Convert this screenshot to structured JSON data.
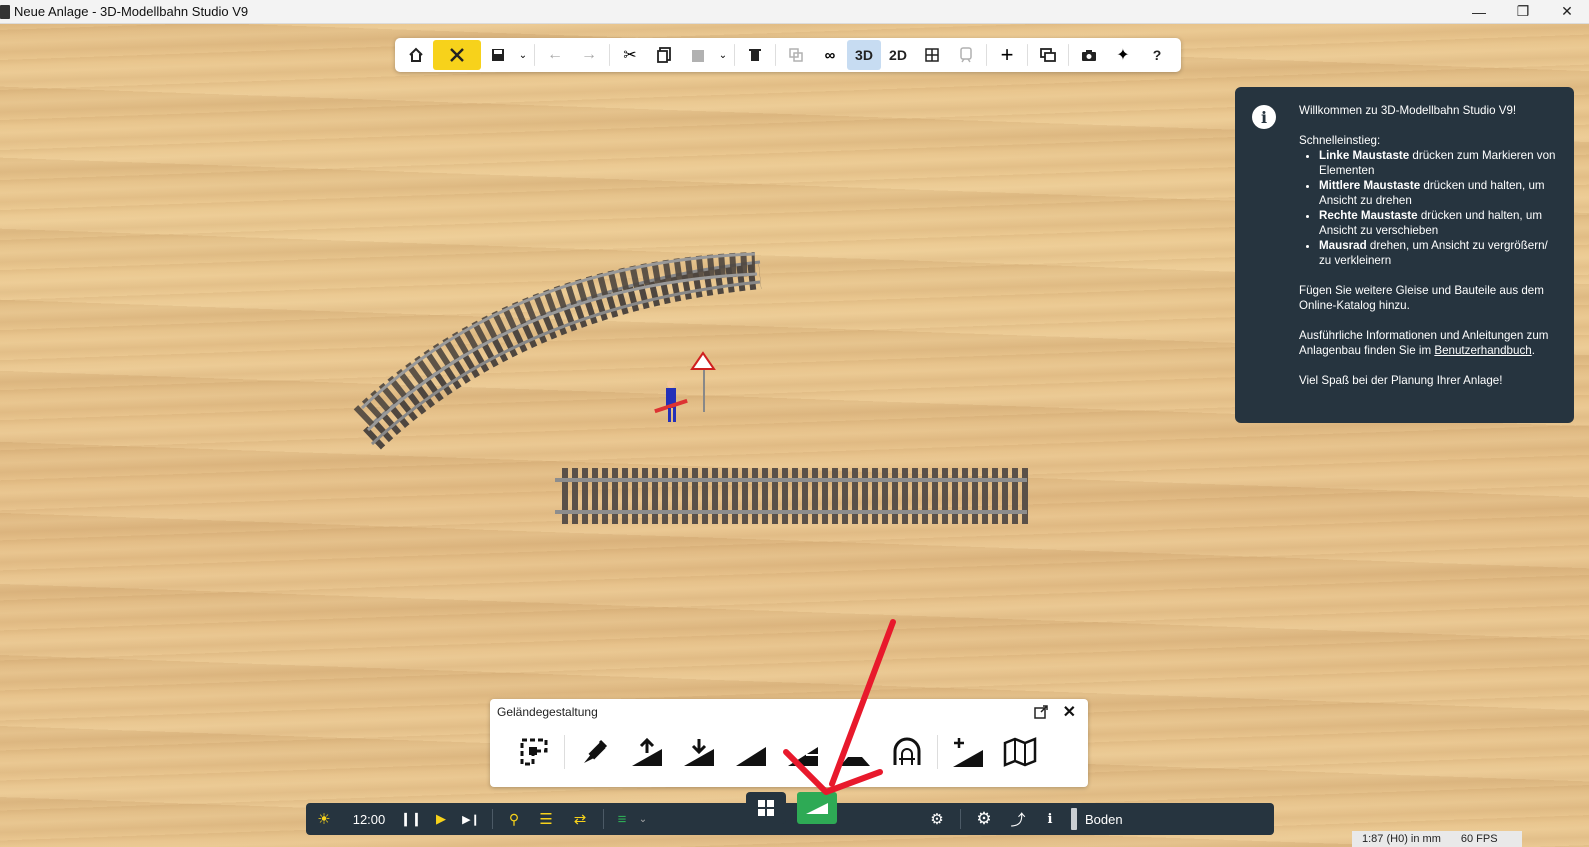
{
  "window": {
    "title": "Neue Anlage - 3D-Modellbahn Studio V9",
    "controls": [
      "minimize-icon",
      "restore-icon",
      "close-icon"
    ]
  },
  "toolbar": {
    "view_3d": "3D",
    "view_2d": "2D",
    "help": "?",
    "icons": [
      "home-icon",
      "tools-icon",
      "save-icon",
      "undo-icon",
      "redo-icon",
      "cut-icon",
      "copy-icon",
      "paste-icon",
      "delete-icon",
      "group-icon",
      "link-icon",
      "grid-view-icon",
      "train-icon",
      "add-icon",
      "windows-icon",
      "camera-icon",
      "plugin-icon"
    ]
  },
  "info_panel": {
    "welcome": "Willkommen zu 3D-Modellbahn Studio V9!",
    "quickstart_title": "Schnelleinstieg:",
    "tips": [
      {
        "bold": "Linke Maustaste",
        "text": " drücken zum Markieren von Elementen"
      },
      {
        "bold": "Mittlere Maustaste",
        "text": " drücken und halten, um Ansicht zu drehen"
      },
      {
        "bold": "Rechte Maustaste",
        "text": " drücken und halten, um Ansicht zu verschieben"
      },
      {
        "bold": "Mausrad",
        "text": " drehen, um Ansicht zu vergrößern/ zu verkleinern"
      }
    ],
    "catalog_text": "Fügen Sie weitere Gleise und Bauteile aus dem Online-Katalog hinzu.",
    "manual_text": "Ausführliche Informationen und Anleitungen zum Anlagenbau finden Sie im ",
    "manual_link": "Benutzerhandbuch",
    "manual_end": ".",
    "closing": "Viel Spaß bei der Planung Ihrer Anlage!"
  },
  "terrain_panel": {
    "title": "Geländegestaltung",
    "tools": [
      "terrain-select-icon",
      "terrain-paint-icon",
      "terrain-raise-icon",
      "terrain-lower-icon",
      "terrain-slope-icon",
      "terrain-flatten-icon",
      "terrain-embankment-icon",
      "tunnel-icon",
      "terrain-add-icon",
      "terrain-map-icon"
    ]
  },
  "bottom_bar": {
    "time": "12:00",
    "layer": "Boden"
  },
  "status_bar": {
    "scale": "1:87 (H0) in mm",
    "fps": "60 FPS"
  },
  "colors": {
    "dark_panel": "#26343f",
    "accent_yellow": "#f7d21b",
    "active_blue": "#c7dcf2",
    "terrain_green": "#2eaa55",
    "annotation_red": "#e8192c"
  }
}
